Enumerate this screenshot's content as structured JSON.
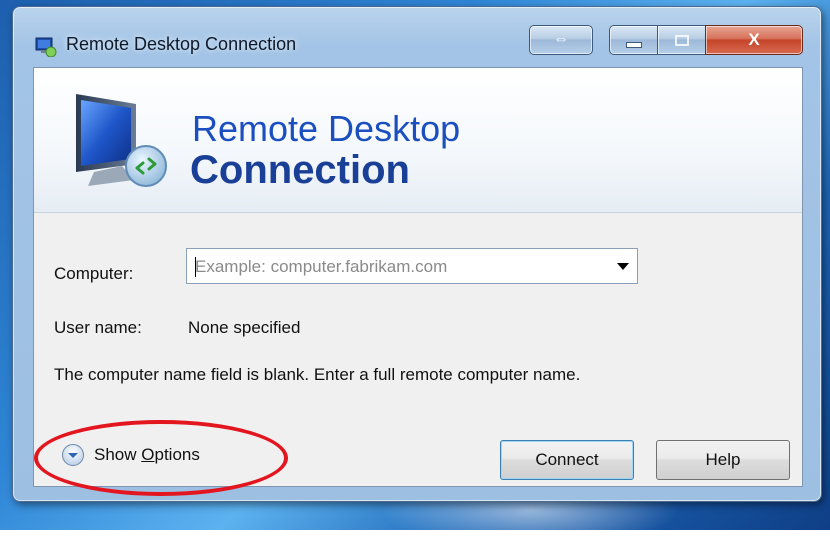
{
  "window": {
    "title": "Remote Desktop Connection",
    "caption_buttons": {
      "resize_symbol": "⇔",
      "minimize_icon": "minimize-icon",
      "maximize_icon": "maximize-icon",
      "close_symbol": "X"
    }
  },
  "banner": {
    "line1": "Remote Desktop",
    "line2": "Connection"
  },
  "form": {
    "computer_label": "Computer:",
    "computer_placeholder": "Example: computer.fabrikam.com",
    "computer_value": "",
    "user_label": "User name:",
    "user_value": "None specified",
    "message": "The computer name field is blank. Enter a full remote computer name."
  },
  "footer": {
    "show_options_prefix": "Show ",
    "show_options_underlined": "O",
    "show_options_suffix": "ptions",
    "connect_label": "Connect",
    "help_label": "Help"
  },
  "colors": {
    "banner_title": "#1b4fbf",
    "annotation_circle": "#e3161f"
  }
}
